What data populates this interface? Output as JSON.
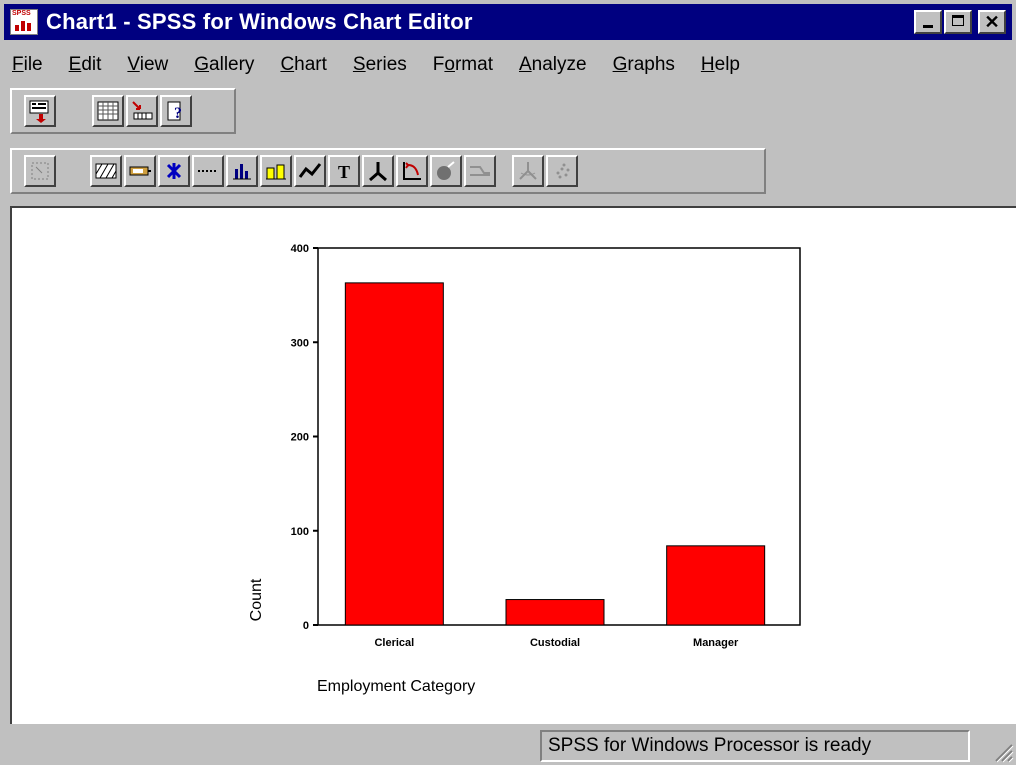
{
  "window": {
    "title": "Chart1 - SPSS for Windows Chart Editor",
    "icon": "spss-chart-icon",
    "close_glyph": "✕"
  },
  "menu": [
    {
      "label": "File",
      "ul": "F",
      "rest": "ile"
    },
    {
      "label": "Edit",
      "ul": "E",
      "rest": "dit"
    },
    {
      "label": "View",
      "ul": "V",
      "rest": "iew"
    },
    {
      "label": "Gallery",
      "ul": "G",
      "rest": "allery"
    },
    {
      "label": "Chart",
      "ul": "C",
      "rest": "hart"
    },
    {
      "label": "Series",
      "ul": "S",
      "rest": "eries"
    },
    {
      "label": "Format",
      "pre": "F",
      "ul": "o",
      "rest": "rmat"
    },
    {
      "label": "Analyze",
      "ul": "A",
      "rest": "nalyze"
    },
    {
      "label": "Graphs",
      "ul": "G",
      "rest": "raphs"
    },
    {
      "label": "Help",
      "ul": "H",
      "rest": "elp"
    }
  ],
  "toolbar_main_icons": [
    "chart-to-viewer-icon",
    "data-editor-icon",
    "goto-case-icon",
    "help-topic-icon"
  ],
  "toolbar_chart_icons": [
    "select-point-icon",
    "fill-pattern-icon",
    "color-icon",
    "marker-icon",
    "line-style-icon",
    "bar-style-icon",
    "bar-label-icon",
    "interpolation-icon",
    "text-icon",
    "reference-line-icon",
    "swap-axes-icon",
    "explode-slice-icon",
    "break-line-icon",
    "spin-mode-icon",
    "point-id-icon"
  ],
  "chart_data": {
    "type": "bar",
    "categories": [
      "Clerical",
      "Custodial",
      "Manager"
    ],
    "values": [
      363,
      27,
      84
    ],
    "ylabel": "Count",
    "xlabel": "Employment Category",
    "ylim": [
      0,
      400
    ],
    "yticks": [
      0,
      100,
      200,
      300,
      400
    ],
    "bar_color": "#ff0000"
  },
  "status": {
    "text": "SPSS for Windows Processor is ready"
  }
}
